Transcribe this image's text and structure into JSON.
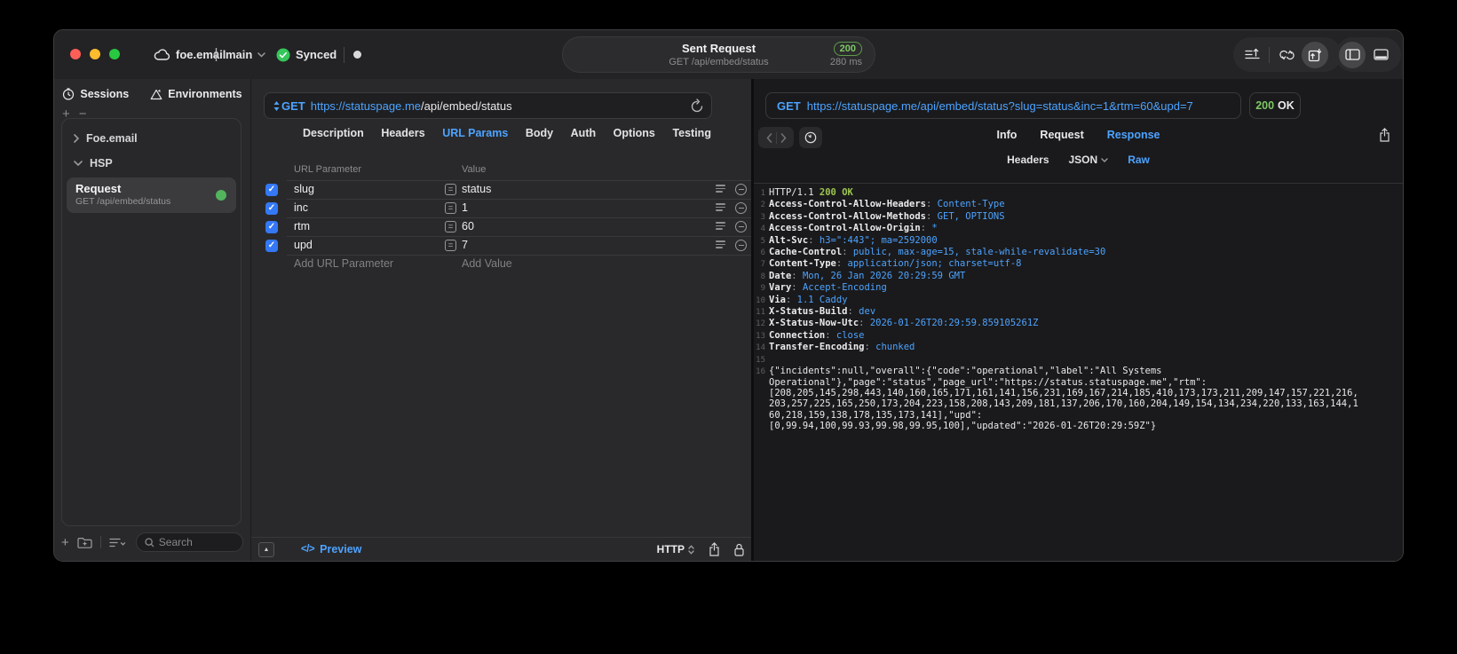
{
  "titlebar": {
    "project": "foe.email",
    "branch": "main",
    "sync": "Synced",
    "request_title": "Sent Request",
    "request_subtitle": "GET /api/embed/status",
    "status_code": "200",
    "duration": "280 ms"
  },
  "sidebar": {
    "tabs": {
      "sessions": "Sessions",
      "environments": "Environments"
    },
    "add_label": "+",
    "remove_label": "−",
    "tree": {
      "group1": "Foe.email",
      "group2": "HSP"
    },
    "request_item": {
      "title": "Request",
      "subtitle": "GET /api/embed/status"
    },
    "search_placeholder": "Search"
  },
  "request_panel": {
    "method": "GET",
    "url_host": "https://statuspage.me",
    "url_path": "/api/embed/status",
    "tabs": [
      "Description",
      "Headers",
      "URL Params",
      "Body",
      "Auth",
      "Options",
      "Testing"
    ],
    "active_tab": "URL Params",
    "table": {
      "col_param": "URL Parameter",
      "col_value": "Value",
      "rows": [
        {
          "name": "slug",
          "value": "status",
          "checked": true
        },
        {
          "name": "inc",
          "value": "1",
          "checked": true
        },
        {
          "name": "rtm",
          "value": "60",
          "checked": true
        },
        {
          "name": "upd",
          "value": "7",
          "checked": true
        }
      ],
      "add_param": "Add URL Parameter",
      "add_value": "Add Value"
    },
    "footer": {
      "code_glyph": "</>",
      "preview": "Preview",
      "protocol": "HTTP"
    }
  },
  "response_panel": {
    "method": "GET",
    "url": "https://statuspage.me/api/embed/status?slug=status&inc=1&rtm=60&upd=7",
    "status_code": "200",
    "status_text": "OK",
    "tabs": [
      "Info",
      "Request",
      "Response"
    ],
    "active_tab": "Response",
    "subtabs": [
      "Headers",
      "JSON",
      "Raw"
    ],
    "active_subtab": "Raw",
    "code_lines": [
      {
        "n": "1",
        "segs": [
          {
            "t": "HTTP/1.1 ",
            "c": "plain"
          },
          {
            "t": "200 OK",
            "c": "green"
          }
        ]
      },
      {
        "n": "2",
        "segs": [
          {
            "t": "Access-Control-Allow-Headers",
            "c": "name"
          },
          {
            "t": ": ",
            "c": "dim"
          },
          {
            "t": "Content-Type",
            "c": "blue"
          }
        ]
      },
      {
        "n": "3",
        "segs": [
          {
            "t": "Access-Control-Allow-Methods",
            "c": "name"
          },
          {
            "t": ": ",
            "c": "dim"
          },
          {
            "t": "GET, OPTIONS",
            "c": "blue"
          }
        ]
      },
      {
        "n": "4",
        "segs": [
          {
            "t": "Access-Control-Allow-Origin",
            "c": "name"
          },
          {
            "t": ": ",
            "c": "dim"
          },
          {
            "t": "*",
            "c": "blue"
          }
        ]
      },
      {
        "n": "5",
        "segs": [
          {
            "t": "Alt-Svc",
            "c": "name"
          },
          {
            "t": ": ",
            "c": "dim"
          },
          {
            "t": "h3=\":443\"; ma=2592000",
            "c": "blue"
          }
        ]
      },
      {
        "n": "6",
        "segs": [
          {
            "t": "Cache-Control",
            "c": "name"
          },
          {
            "t": ": ",
            "c": "dim"
          },
          {
            "t": "public, max-age=15, stale-while-revalidate=30",
            "c": "blue"
          }
        ]
      },
      {
        "n": "7",
        "segs": [
          {
            "t": "Content-Type",
            "c": "name"
          },
          {
            "t": ": ",
            "c": "dim"
          },
          {
            "t": "application/json; charset=utf-8",
            "c": "blue"
          }
        ]
      },
      {
        "n": "8",
        "segs": [
          {
            "t": "Date",
            "c": "name"
          },
          {
            "t": ": ",
            "c": "dim"
          },
          {
            "t": "Mon, 26 Jan 2026 20:29:59 GMT",
            "c": "blue"
          }
        ]
      },
      {
        "n": "9",
        "segs": [
          {
            "t": "Vary",
            "c": "name"
          },
          {
            "t": ": ",
            "c": "dim"
          },
          {
            "t": "Accept-Encoding",
            "c": "blue"
          }
        ]
      },
      {
        "n": "10",
        "segs": [
          {
            "t": "Via",
            "c": "name"
          },
          {
            "t": ": ",
            "c": "dim"
          },
          {
            "t": "1.1 Caddy",
            "c": "blue"
          }
        ]
      },
      {
        "n": "11",
        "segs": [
          {
            "t": "X-Status-Build",
            "c": "name"
          },
          {
            "t": ": ",
            "c": "dim"
          },
          {
            "t": "dev",
            "c": "blue"
          }
        ]
      },
      {
        "n": "12",
        "segs": [
          {
            "t": "X-Status-Now-Utc",
            "c": "name"
          },
          {
            "t": ": ",
            "c": "dim"
          },
          {
            "t": "2026-01-26T20:29:59.859105261Z",
            "c": "blue"
          }
        ]
      },
      {
        "n": "13",
        "segs": [
          {
            "t": "Connection",
            "c": "name"
          },
          {
            "t": ": ",
            "c": "dim"
          },
          {
            "t": "close",
            "c": "blue"
          }
        ]
      },
      {
        "n": "14",
        "segs": [
          {
            "t": "Transfer-Encoding",
            "c": "name"
          },
          {
            "t": ": ",
            "c": "dim"
          },
          {
            "t": "chunked",
            "c": "blue"
          }
        ]
      },
      {
        "n": "15",
        "segs": []
      },
      {
        "n": "16",
        "segs": [
          {
            "t": "{\"incidents\":null,\"overall\":{\"code\":\"operational\",\"label\":\"All Systems\nOperational\"},\"page\":\"status\",\"page_url\":\"https://status.statuspage.me\",\"rtm\":\n[208,205,145,298,443,140,160,165,171,161,141,156,231,169,167,214,185,410,173,173,211,209,147,157,221,216,\n203,257,225,165,250,173,204,223,158,208,143,209,181,137,206,170,160,204,149,154,134,234,220,133,163,144,1\n60,218,159,138,178,135,173,141],\"upd\":\n[0,99.94,100,99.93,99.98,99.95,100],\"updated\":\"2026-01-26T20:29:59Z\"}",
            "c": "plain"
          }
        ]
      }
    ]
  },
  "icons": {
    "chevron_down": "⌄",
    "chevron_right": "›",
    "chevron_left": "‹",
    "check": "✓",
    "equals": "=",
    "collapse_triangle": "▲"
  },
  "colors": {
    "accent_blue": "#4da3ff",
    "code_green": "#9dc64e",
    "badge_green": "#7ec964",
    "checkbox_blue": "#3478f6",
    "status_dot_green": "#53b45e",
    "traffic_red": "#ff5f57",
    "traffic_yellow": "#febc2e",
    "traffic_green": "#28c840"
  }
}
